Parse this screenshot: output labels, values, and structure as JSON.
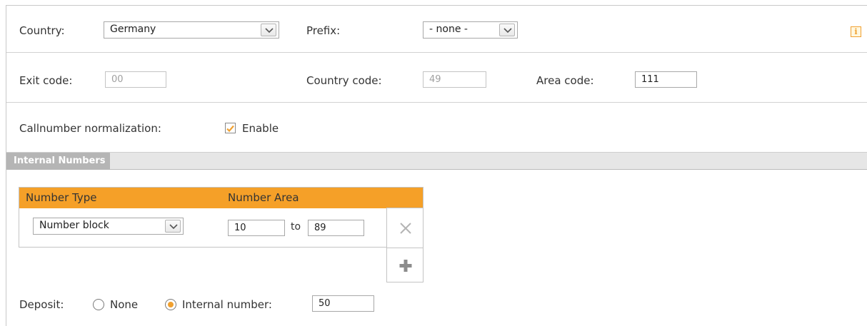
{
  "country": {
    "label": "Country:",
    "value": "Germany"
  },
  "prefix": {
    "label": "Prefix:",
    "value": "- none -"
  },
  "info": {
    "icon": "info-icon",
    "glyph": "i",
    "color": "#f0a030"
  },
  "exit_code": {
    "label": "Exit code:",
    "value": "00"
  },
  "country_code": {
    "label": "Country code:",
    "value": "49"
  },
  "area_code": {
    "label": "Area code:",
    "value": "111"
  },
  "normalization": {
    "label": "Callnumber normalization:",
    "checkbox_label": "Enable",
    "checked": true
  },
  "internal_numbers": {
    "title": "Internal Numbers",
    "columns": [
      "Number Type",
      "Number Area"
    ],
    "rows": [
      {
        "type": "Number block",
        "from": "10",
        "to_label": "to",
        "to": "89"
      }
    ]
  },
  "deposit": {
    "label": "Deposit:",
    "option_none": "None",
    "option_internal": "Internal number:",
    "selected": "internal",
    "internal_value": "50"
  },
  "colors": {
    "accent": "#f5a028",
    "section_bar": "#e6e6e6",
    "section_title_bg": "#b5b5b5"
  }
}
